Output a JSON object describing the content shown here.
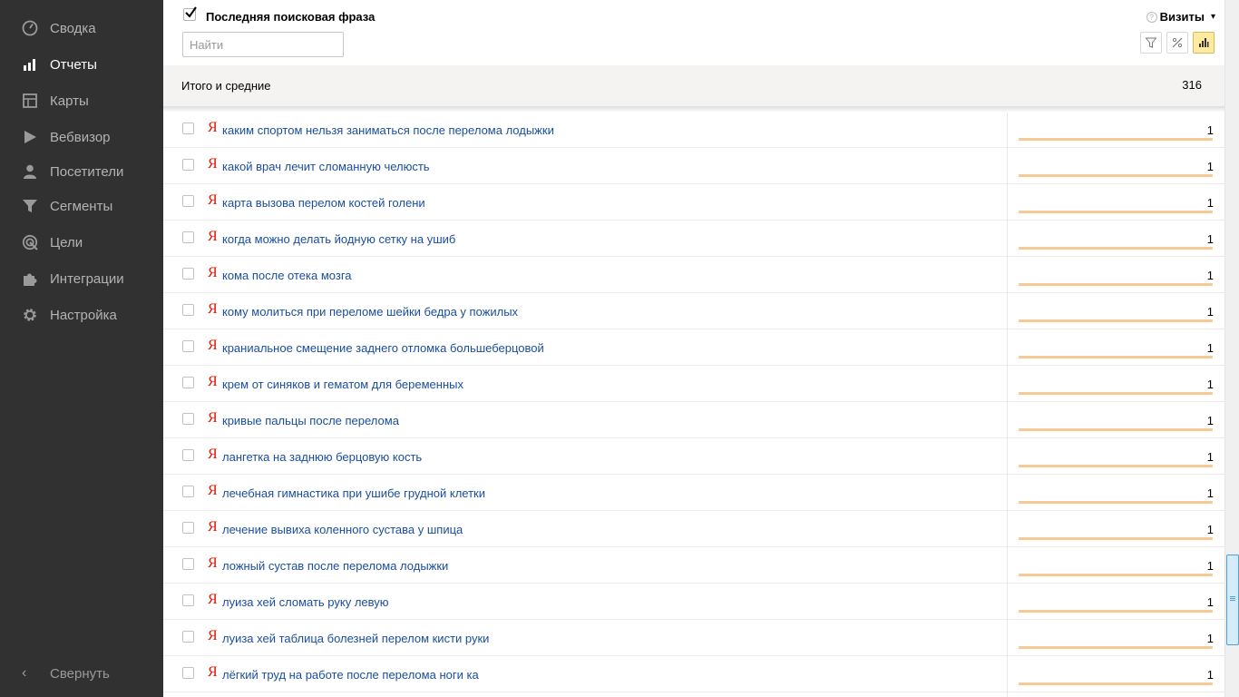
{
  "sidebar": {
    "items": [
      {
        "label": "Сводка",
        "icon": "speedometer-icon",
        "active": false
      },
      {
        "label": "Отчеты",
        "icon": "bar-chart-icon",
        "active": true
      },
      {
        "label": "Карты",
        "icon": "map-grid-icon",
        "active": false
      },
      {
        "label": "Вебвизор",
        "icon": "play-icon",
        "active": false
      },
      {
        "label": "Посетители",
        "icon": "person-icon",
        "active": false
      },
      {
        "label": "Сегменты",
        "icon": "funnel-icon",
        "active": false
      },
      {
        "label": "Цели",
        "icon": "target-icon",
        "active": false
      },
      {
        "label": "Интеграции",
        "icon": "puzzle-icon",
        "active": false
      },
      {
        "label": "Настройка",
        "icon": "gear-icon",
        "active": false
      }
    ],
    "collapse_label": "Свернуть"
  },
  "header": {
    "dimension_title": "Последняя поисковая фраза",
    "search_placeholder": "Найти",
    "metric_label": "Визиты",
    "help_glyph": "?",
    "caret": "▾"
  },
  "totals": {
    "label": "Итого и средние",
    "value": "316"
  },
  "rows": [
    {
      "phrase": "каким спортом нельзя заниматься после перелома лодыжки",
      "visits": "1"
    },
    {
      "phrase": "какой врач лечит сломанную челюсть",
      "visits": "1"
    },
    {
      "phrase": "карта вызова перелом костей голени",
      "visits": "1"
    },
    {
      "phrase": "когда можно делать йодную сетку на ушиб",
      "visits": "1"
    },
    {
      "phrase": "кома после отека мозга",
      "visits": "1"
    },
    {
      "phrase": "кому молиться при переломе шейки бедра у пожилых",
      "visits": "1"
    },
    {
      "phrase": "краниальное смещение заднего отломка большеберцовой",
      "visits": "1"
    },
    {
      "phrase": "крем от синяков и гематом для беременных",
      "visits": "1"
    },
    {
      "phrase": "кривые пальцы после перелома",
      "visits": "1"
    },
    {
      "phrase": "лангетка на заднюю берцовую кость",
      "visits": "1"
    },
    {
      "phrase": "лечебная гимнастика при ушибе грудной клетки",
      "visits": "1"
    },
    {
      "phrase": "лечение вывиха коленного сустава у шпица",
      "visits": "1"
    },
    {
      "phrase": "ложный сустав после перелома лодыжки",
      "visits": "1"
    },
    {
      "phrase": "луиза хей сломать руку левую",
      "visits": "1"
    },
    {
      "phrase": "луиза хей таблица болезней перелом кисти руки",
      "visits": "1"
    },
    {
      "phrase": "лёгкий труд на работе после перелома ноги ка",
      "visits": "1"
    }
  ],
  "row_marker": "Я",
  "colors": {
    "sidebar_bg": "#313131",
    "link": "#1a4d9f",
    "yandex_red": "#e61400",
    "bar": "#f6c893",
    "active_tool": "#ffeba0"
  }
}
